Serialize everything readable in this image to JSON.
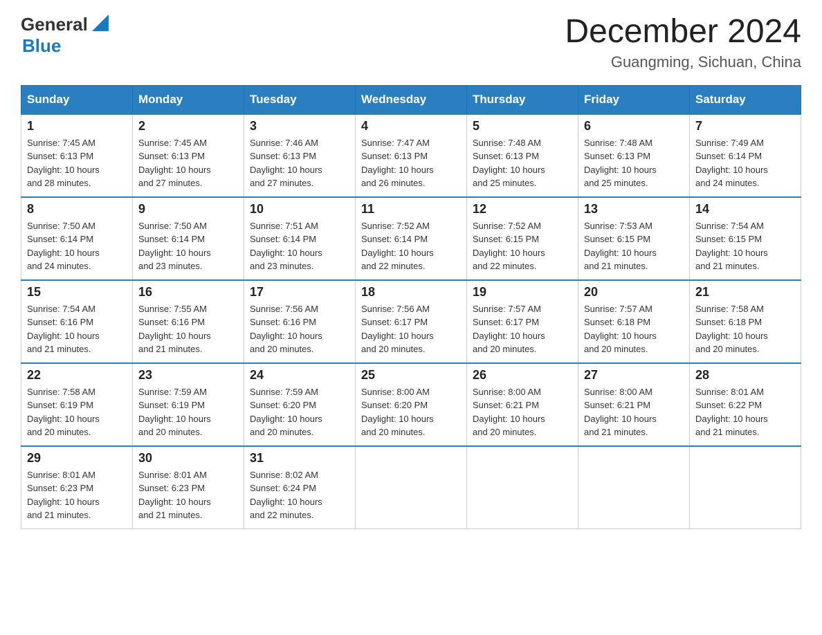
{
  "logo": {
    "text_general": "General",
    "text_blue": "Blue"
  },
  "title": "December 2024",
  "subtitle": "Guangming, Sichuan, China",
  "headers": [
    "Sunday",
    "Monday",
    "Tuesday",
    "Wednesday",
    "Thursday",
    "Friday",
    "Saturday"
  ],
  "weeks": [
    [
      {
        "day": "1",
        "info": "Sunrise: 7:45 AM\nSunset: 6:13 PM\nDaylight: 10 hours\nand 28 minutes."
      },
      {
        "day": "2",
        "info": "Sunrise: 7:45 AM\nSunset: 6:13 PM\nDaylight: 10 hours\nand 27 minutes."
      },
      {
        "day": "3",
        "info": "Sunrise: 7:46 AM\nSunset: 6:13 PM\nDaylight: 10 hours\nand 27 minutes."
      },
      {
        "day": "4",
        "info": "Sunrise: 7:47 AM\nSunset: 6:13 PM\nDaylight: 10 hours\nand 26 minutes."
      },
      {
        "day": "5",
        "info": "Sunrise: 7:48 AM\nSunset: 6:13 PM\nDaylight: 10 hours\nand 25 minutes."
      },
      {
        "day": "6",
        "info": "Sunrise: 7:48 AM\nSunset: 6:13 PM\nDaylight: 10 hours\nand 25 minutes."
      },
      {
        "day": "7",
        "info": "Sunrise: 7:49 AM\nSunset: 6:14 PM\nDaylight: 10 hours\nand 24 minutes."
      }
    ],
    [
      {
        "day": "8",
        "info": "Sunrise: 7:50 AM\nSunset: 6:14 PM\nDaylight: 10 hours\nand 24 minutes."
      },
      {
        "day": "9",
        "info": "Sunrise: 7:50 AM\nSunset: 6:14 PM\nDaylight: 10 hours\nand 23 minutes."
      },
      {
        "day": "10",
        "info": "Sunrise: 7:51 AM\nSunset: 6:14 PM\nDaylight: 10 hours\nand 23 minutes."
      },
      {
        "day": "11",
        "info": "Sunrise: 7:52 AM\nSunset: 6:14 PM\nDaylight: 10 hours\nand 22 minutes."
      },
      {
        "day": "12",
        "info": "Sunrise: 7:52 AM\nSunset: 6:15 PM\nDaylight: 10 hours\nand 22 minutes."
      },
      {
        "day": "13",
        "info": "Sunrise: 7:53 AM\nSunset: 6:15 PM\nDaylight: 10 hours\nand 21 minutes."
      },
      {
        "day": "14",
        "info": "Sunrise: 7:54 AM\nSunset: 6:15 PM\nDaylight: 10 hours\nand 21 minutes."
      }
    ],
    [
      {
        "day": "15",
        "info": "Sunrise: 7:54 AM\nSunset: 6:16 PM\nDaylight: 10 hours\nand 21 minutes."
      },
      {
        "day": "16",
        "info": "Sunrise: 7:55 AM\nSunset: 6:16 PM\nDaylight: 10 hours\nand 21 minutes."
      },
      {
        "day": "17",
        "info": "Sunrise: 7:56 AM\nSunset: 6:16 PM\nDaylight: 10 hours\nand 20 minutes."
      },
      {
        "day": "18",
        "info": "Sunrise: 7:56 AM\nSunset: 6:17 PM\nDaylight: 10 hours\nand 20 minutes."
      },
      {
        "day": "19",
        "info": "Sunrise: 7:57 AM\nSunset: 6:17 PM\nDaylight: 10 hours\nand 20 minutes."
      },
      {
        "day": "20",
        "info": "Sunrise: 7:57 AM\nSunset: 6:18 PM\nDaylight: 10 hours\nand 20 minutes."
      },
      {
        "day": "21",
        "info": "Sunrise: 7:58 AM\nSunset: 6:18 PM\nDaylight: 10 hours\nand 20 minutes."
      }
    ],
    [
      {
        "day": "22",
        "info": "Sunrise: 7:58 AM\nSunset: 6:19 PM\nDaylight: 10 hours\nand 20 minutes."
      },
      {
        "day": "23",
        "info": "Sunrise: 7:59 AM\nSunset: 6:19 PM\nDaylight: 10 hours\nand 20 minutes."
      },
      {
        "day": "24",
        "info": "Sunrise: 7:59 AM\nSunset: 6:20 PM\nDaylight: 10 hours\nand 20 minutes."
      },
      {
        "day": "25",
        "info": "Sunrise: 8:00 AM\nSunset: 6:20 PM\nDaylight: 10 hours\nand 20 minutes."
      },
      {
        "day": "26",
        "info": "Sunrise: 8:00 AM\nSunset: 6:21 PM\nDaylight: 10 hours\nand 20 minutes."
      },
      {
        "day": "27",
        "info": "Sunrise: 8:00 AM\nSunset: 6:21 PM\nDaylight: 10 hours\nand 21 minutes."
      },
      {
        "day": "28",
        "info": "Sunrise: 8:01 AM\nSunset: 6:22 PM\nDaylight: 10 hours\nand 21 minutes."
      }
    ],
    [
      {
        "day": "29",
        "info": "Sunrise: 8:01 AM\nSunset: 6:23 PM\nDaylight: 10 hours\nand 21 minutes."
      },
      {
        "day": "30",
        "info": "Sunrise: 8:01 AM\nSunset: 6:23 PM\nDaylight: 10 hours\nand 21 minutes."
      },
      {
        "day": "31",
        "info": "Sunrise: 8:02 AM\nSunset: 6:24 PM\nDaylight: 10 hours\nand 22 minutes."
      },
      {
        "day": "",
        "info": ""
      },
      {
        "day": "",
        "info": ""
      },
      {
        "day": "",
        "info": ""
      },
      {
        "day": "",
        "info": ""
      }
    ]
  ]
}
